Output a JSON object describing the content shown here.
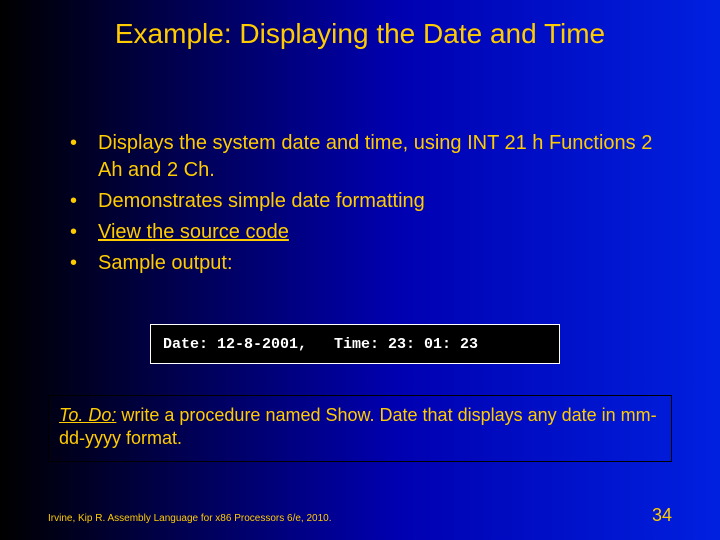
{
  "title": "Example: Displaying the Date and Time",
  "bullets": [
    {
      "text": "Displays the system date and time, using INT 21 h Functions 2 Ah and 2 Ch.",
      "link": false
    },
    {
      "text": "Demonstrates simple date formatting",
      "link": false
    },
    {
      "text": "View the source code",
      "link": true
    },
    {
      "text": "Sample output:",
      "link": false
    }
  ],
  "sample_output": "Date: 12-8-2001,   Time: 23: 01: 23",
  "todo": {
    "lead": "To. Do:",
    "rest": " write a procedure named Show. Date that displays any date in mm-dd-yyyy format."
  },
  "footer": "Irvine, Kip R. Assembly Language for x86 Processors 6/e, 2010.",
  "page_number": "34"
}
